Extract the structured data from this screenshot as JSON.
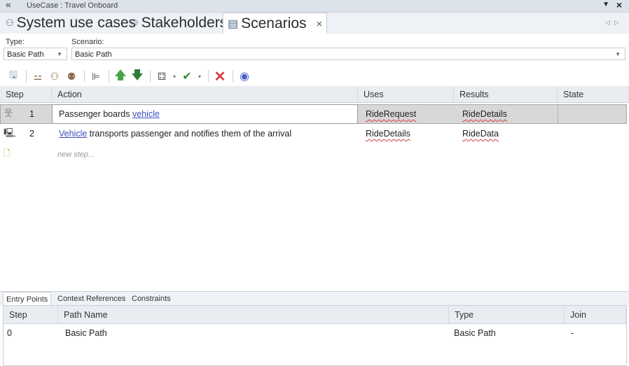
{
  "window": {
    "title": "UseCase : Travel Onboard"
  },
  "tabs": [
    {
      "label": "System use cases",
      "icon": "actor-pair-icon"
    },
    {
      "label": "Stakeholders",
      "icon": "actor-pair-icon"
    },
    {
      "label": "Scenarios",
      "icon": "list-view-icon",
      "active": true
    }
  ],
  "form": {
    "type_label": "Type:",
    "type_value": "Basic Path",
    "scenario_label": "Scenario:",
    "scenario_value": "Basic Path"
  },
  "toolbar": {
    "icons": [
      "save-icon",
      "generate-structure-icon",
      "actor-icon",
      "system-icon",
      "hierarchy-icon",
      "move-up-icon",
      "move-down-icon",
      "diagram-icon",
      "validate-icon",
      "delete-icon",
      "help-icon"
    ]
  },
  "grid": {
    "headers": [
      "Step",
      "Action",
      "Uses",
      "Results",
      "State"
    ],
    "rows": [
      {
        "step": "1",
        "action_pre": "Passenger boards ",
        "action_link": "vehicle",
        "action_post": "",
        "uses": "RideRequest",
        "results": "RideDetails",
        "state": ""
      },
      {
        "step": "2",
        "action_pre": "",
        "action_link": "Vehicle",
        "action_post": " transports passenger and notifies them of the arrival",
        "uses": "RideDetails",
        "results": "RideData",
        "state": ""
      }
    ],
    "new_step_placeholder": "new step..."
  },
  "bottom": {
    "tabs": [
      "Entry Points",
      "Context References",
      "Constraints"
    ],
    "headers": [
      "Step",
      "Path Name",
      "Type",
      "Join"
    ],
    "rows": [
      {
        "step": "0",
        "path_name": "Basic Path",
        "type": "Basic Path",
        "join": "-"
      }
    ]
  },
  "colors": {
    "link": "#3c4fbd",
    "delete": "#d63a3a",
    "arrow_up": "#49a34b",
    "arrow_down": "#2e7d32",
    "help": "#4a5fd0"
  }
}
